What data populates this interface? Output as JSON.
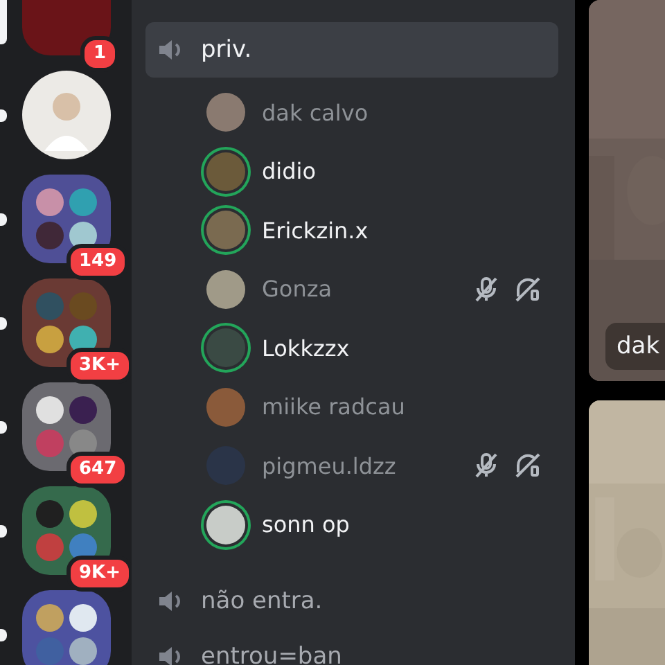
{
  "servers": [
    {
      "kind": "server",
      "color": "#6a1418",
      "badge": "1",
      "selected": true
    },
    {
      "kind": "avatar",
      "color": "#eceae6",
      "selected": false,
      "unread": true
    },
    {
      "kind": "folder",
      "color": "#4f4f96",
      "badge": "149",
      "selected": false,
      "unread": true
    },
    {
      "kind": "folder",
      "color": "#6a3a34",
      "badge": "3K+",
      "selected": false,
      "unread": true
    },
    {
      "kind": "folder",
      "color": "#6b6a70",
      "badge": "647",
      "selected": false,
      "unread": true
    },
    {
      "kind": "folder",
      "color": "#356a4c",
      "badge": "9K+",
      "selected": false,
      "unread": true
    },
    {
      "kind": "folder",
      "color": "#4d52a0",
      "selected": false,
      "unread": true
    }
  ],
  "channels": [
    {
      "name": "priv.",
      "selected": true,
      "users": [
        {
          "name": "dak calvo",
          "speaking": false,
          "muted": false,
          "deafened": false
        },
        {
          "name": "didio",
          "speaking": true,
          "muted": false,
          "deafened": false
        },
        {
          "name": "Erickzin.x",
          "speaking": true,
          "muted": false,
          "deafened": false
        },
        {
          "name": "Gonza",
          "speaking": false,
          "muted": true,
          "deafened": true
        },
        {
          "name": "Lokkzzx",
          "speaking": true,
          "muted": false,
          "deafened": false
        },
        {
          "name": "miike radcau",
          "speaking": false,
          "muted": false,
          "deafened": false
        },
        {
          "name": "pigmeu.ldzz",
          "speaking": false,
          "muted": true,
          "deafened": true
        },
        {
          "name": "sonn op",
          "speaking": true,
          "muted": false,
          "deafened": false
        }
      ]
    },
    {
      "name": "não entra.",
      "selected": false
    },
    {
      "name": "entrou=ban",
      "selected": false
    }
  ],
  "video_tiles": [
    {
      "kind": "picture",
      "name_tag": "dak"
    },
    {
      "kind": "picture"
    }
  ]
}
